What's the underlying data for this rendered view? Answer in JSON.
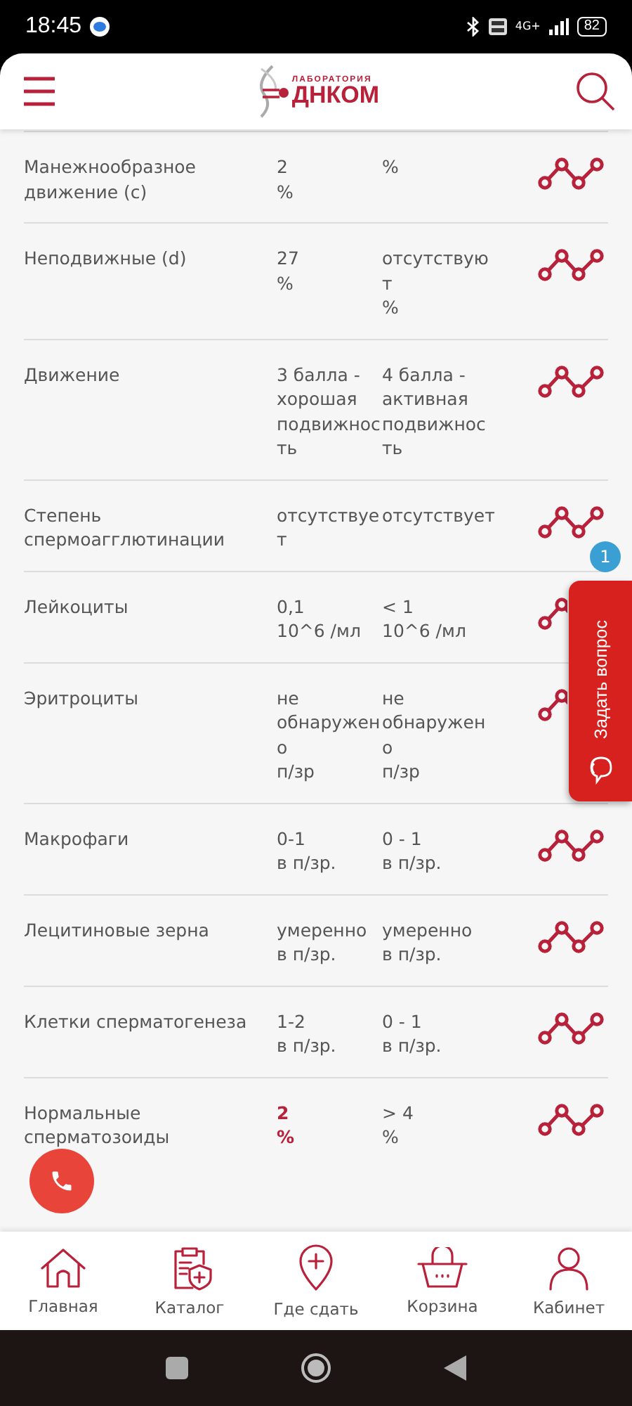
{
  "status_bar": {
    "time": "18:45",
    "network": "4G+",
    "battery": "82"
  },
  "header": {
    "logo_caption": "ЛАБОРАТОРИЯ",
    "logo_name": "ДНКОМ"
  },
  "results": [
    {
      "name": "Манежнообразное движение (c)",
      "result": "2\n%",
      "reference": "%",
      "flagged": false
    },
    {
      "name": "Неподвижные (d)",
      "result": "27\n%",
      "reference": "отсутствую\nт\n%",
      "flagged": false
    },
    {
      "name": "Движение",
      "result": "3 балла -\nхорошая\nподвижнос\nть",
      "reference": "4 балла -\nактивная\nподвижнос\nть",
      "flagged": false
    },
    {
      "name": "Степень спермоагглютинации",
      "result": "отсутствуе\nт",
      "reference": "отсутствует",
      "flagged": false
    },
    {
      "name": "Лейкоциты",
      "result": "0,1\n10^6 /мл",
      "reference": "< 1\n10^6 /мл",
      "flagged": false
    },
    {
      "name": "Эритроциты",
      "result": "не\nобнаружен\nо\nп/зр",
      "reference": "не\nобнаружен\nо\nп/зр",
      "flagged": false
    },
    {
      "name": "Макрофаги",
      "result": "0-1\nв п/зр.",
      "reference": "0 - 1\nв п/зр.",
      "flagged": false
    },
    {
      "name": "Лецитиновые зерна",
      "result": "умеренно\nв п/зр.",
      "reference": "умеренно\nв п/зр.",
      "flagged": false
    },
    {
      "name": "Клетки сперматогенеза",
      "result": "1-2\nв п/зр.",
      "reference": "0 - 1\nв п/зр.",
      "flagged": false
    },
    {
      "name": "Нормальные сперматозоиды",
      "result": "2\n%",
      "reference": "> 4\n%",
      "flagged": true
    }
  ],
  "question_tab": {
    "label": "Задать вопрос",
    "badge": "1"
  },
  "bottom_nav": [
    {
      "label": "Главная",
      "kind": "home"
    },
    {
      "label": "Каталог",
      "kind": "catalog"
    },
    {
      "label": "Где сдать",
      "kind": "pin"
    },
    {
      "label": "Корзина",
      "kind": "basket"
    },
    {
      "label": "Кабинет",
      "kind": "user"
    }
  ]
}
